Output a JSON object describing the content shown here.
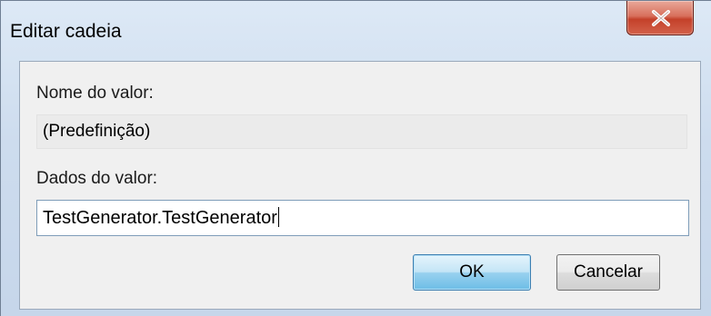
{
  "window": {
    "title": "Editar cadeia"
  },
  "form": {
    "value_name_label": "Nome do valor:",
    "value_name": "(Predefinição)",
    "value_data_label": "Dados do valor:",
    "value_data": "TestGenerator.TestGenerator"
  },
  "buttons": {
    "ok_label": "OK",
    "cancel_label": "Cancelar"
  },
  "icons": {
    "close": "close-icon"
  },
  "colors": {
    "frame": "#cddcee",
    "close_button": "#c4412a",
    "default_button": "#98d1ef"
  }
}
